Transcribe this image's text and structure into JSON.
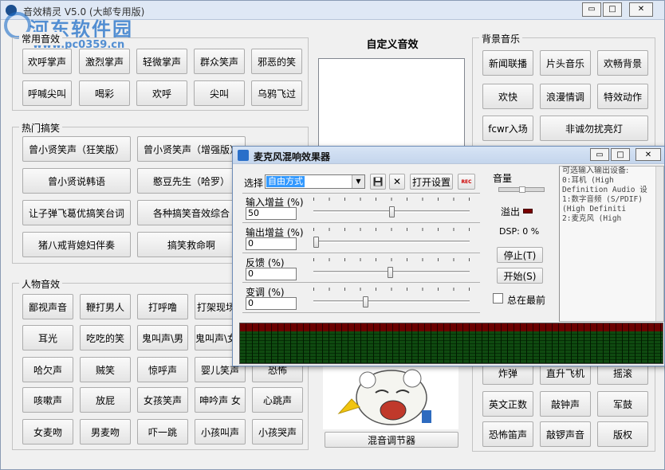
{
  "app": {
    "title": "音效精灵 V5.0 (大邮专用版)",
    "watermark": "河东软件园",
    "watermark_url": "www.pc0359.cn",
    "window_controls": {
      "minimize": "▭",
      "restore": "□",
      "close": "✕"
    }
  },
  "common": {
    "title": "常用音效",
    "buttons": [
      "欢呼掌声",
      "激烈掌声",
      "轻微掌声",
      "群众笑声",
      "邪恶的笑",
      "呼喊尖叫",
      "喝彩",
      "欢呼",
      "尖叫",
      "乌鸦飞过"
    ]
  },
  "hot": {
    "title": "热门搞笑",
    "buttons": [
      "曾小贤笑声（狂笑版）",
      "曾小贤笑声（增强版）",
      "曾小贤说韩语",
      "憨豆先生（哈罗）",
      "让子弹飞葛优搞笑台词",
      "各种搞笑音效综合",
      "猪八戒背媳妇伴奏",
      "搞笑救命啊"
    ]
  },
  "people": {
    "title": "人物音效",
    "buttons": [
      "鄙视声音",
      "鞭打男人",
      "打呼噜",
      "打架现场",
      "耳光",
      "吃吃的笑",
      "鬼叫声\\男",
      "鬼叫声\\女",
      "哈欠声",
      "贼笑",
      "惊呼声",
      "婴儿笑声",
      "恐怖",
      "咳嗽声",
      "放屁",
      "女孩笑声",
      "呻吟声 女",
      "心跳声",
      "女麦吻",
      "男麦吻",
      "吓一跳",
      "小孩叫声",
      "小孩哭声"
    ]
  },
  "custom": {
    "title": "自定义音效",
    "mixer_button": "混音调节器"
  },
  "bg": {
    "title": "背景音乐",
    "buttons": [
      "新闻联播",
      "片头音乐",
      "欢畅背景",
      "欢快",
      "浪漫情调",
      "特效动作",
      "fcwr入场",
      "非诚勿扰亮灯",
      "炸弹",
      "直升飞机",
      "摇滚",
      "英文正数",
      "敲钟声",
      "军鼓",
      "恐怖笛声",
      "敲锣声音",
      "版权"
    ]
  },
  "mic": {
    "title": "麦克风混响效果器",
    "select_label": "选择",
    "select_value": "自由方式",
    "open_settings": "打开设置",
    "rec_badge": "REC",
    "input_gain_label": "输入增益 (%)",
    "input_gain_value": "50",
    "output_gain_label": "输出增益 (%)",
    "output_gain_value": "0",
    "feedback_label": "反馈 (%)",
    "feedback_value": "0",
    "pitch_label": "变调 (%)",
    "pitch_value": "0",
    "volume_label": "音量",
    "overflow_label": "溢出",
    "dsp_label": "DSP: 0 %",
    "stop_button": "停止(T)",
    "start_button": "开始(S)",
    "always_on_top": "总在最前",
    "slider_levels": {
      "input_gain": 0.5,
      "output_gain": 0.0,
      "feedback": 0.49,
      "pitch": 0.33
    },
    "devices_header": "可选输入输出设备:",
    "devices": [
      "0:耳机 (High",
      "Definition Audio 设",
      "1:数字音频 (S/PDIF)",
      "(High Definiti",
      "2:麦克风 (High"
    ]
  }
}
